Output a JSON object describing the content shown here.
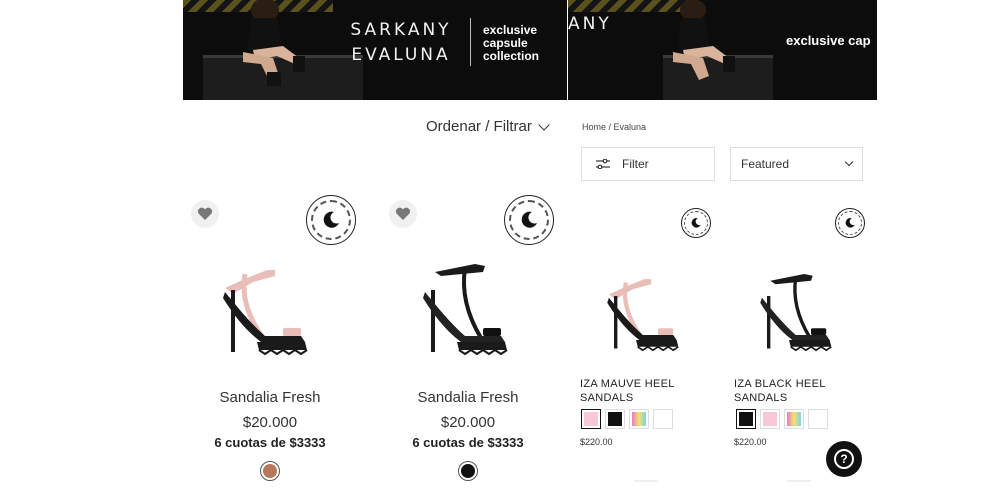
{
  "left_panel": {
    "banner": {
      "brand_line1": "SARKANY",
      "brand_line2": "EVALUNA",
      "caption_line1": "exclusive",
      "caption_line2": "capsule",
      "caption_line3": "collection"
    },
    "sort_filter_label": "Ordenar / Filtrar",
    "products": [
      {
        "name": "Sandalia Fresh",
        "price": "$20.000",
        "installments": "6 cuotas de $3333",
        "swatch_color": "#b7775a",
        "shoe_color": "#e9bdb8"
      },
      {
        "name": "Sandalia Fresh",
        "price": "$20.000",
        "installments": "6 cuotas de $3333",
        "swatch_color": "#111111",
        "shoe_color": "#1a1a1a"
      }
    ]
  },
  "right_panel": {
    "banner": {
      "brand_partial": "ANY",
      "caption": "exclusive cap"
    },
    "breadcrumb": "Home / Evaluna",
    "filter_label": "Filter",
    "sort_label": "Featured",
    "products": [
      {
        "name": "IZA MAUVE HEEL SANDALS",
        "price": "$220.00",
        "shoe_color": "#e9bdb8",
        "swatches": [
          "#f7c9d6",
          "#111111",
          "gradient",
          "#ffffff"
        ],
        "selected": 0
      },
      {
        "name": "IZA BLACK HEEL SANDALS",
        "price": "$220.00",
        "shoe_color": "#1a1a1a",
        "swatches": [
          "#111111",
          "#f7c9d6",
          "gradient",
          "#ffffff"
        ],
        "selected": 0
      }
    ],
    "help_label": "?"
  },
  "colors": {
    "banner_bg": "#0c0c0c",
    "accent": "#111111"
  }
}
